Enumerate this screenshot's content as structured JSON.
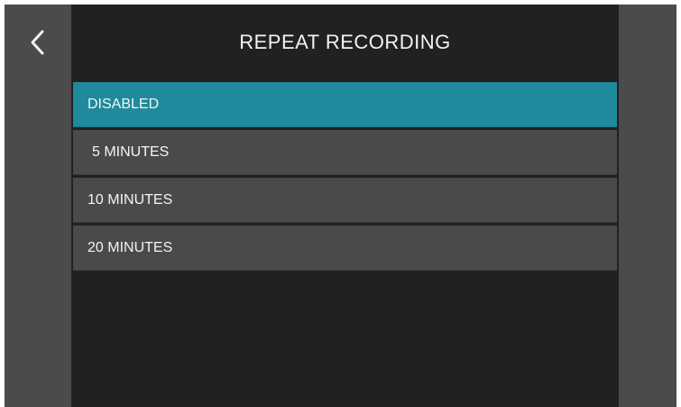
{
  "header": {
    "title": "REPEAT RECORDING",
    "back_icon": "chevron-left-icon"
  },
  "options": [
    {
      "label": "DISABLED",
      "selected": true
    },
    {
      "label": "5 MINUTES",
      "selected": false
    },
    {
      "label": "10 MINUTES",
      "selected": false
    },
    {
      "label": "20 MINUTES",
      "selected": false
    }
  ],
  "colors": {
    "selected": "#1e8a9c",
    "option_bg": "#4a4a4a",
    "main_bg": "#212121",
    "side_bg": "#4b4b4b"
  }
}
